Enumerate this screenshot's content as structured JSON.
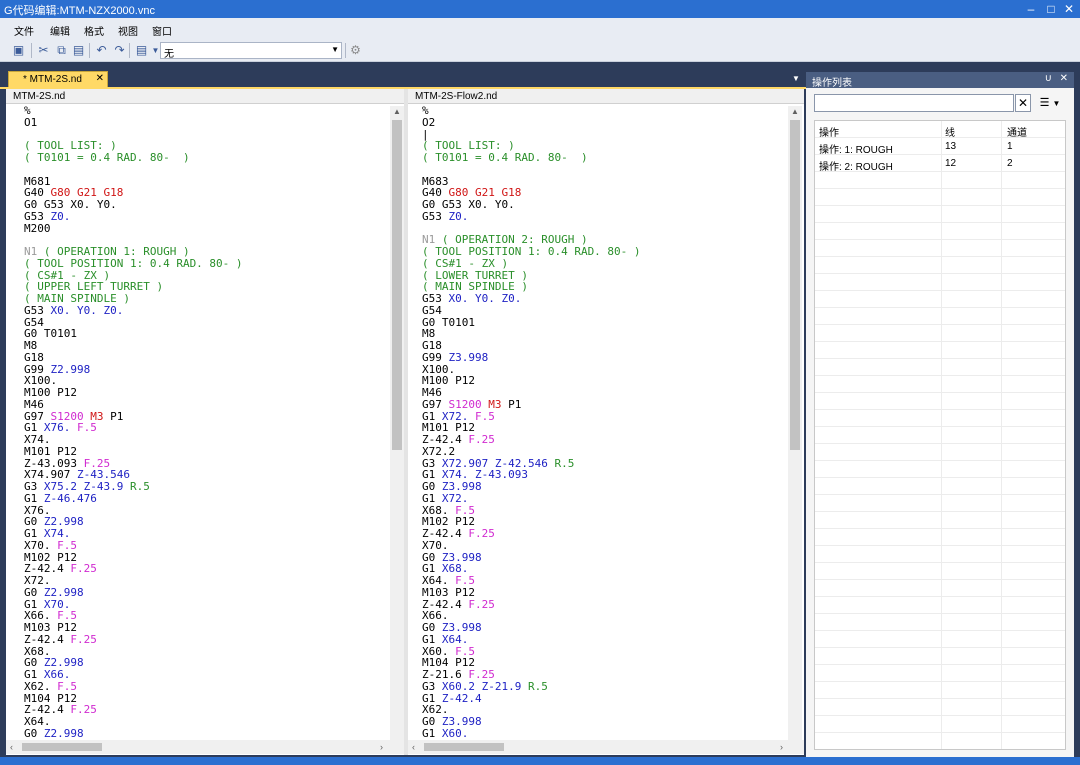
{
  "window": {
    "title": "G代码编辑:MTM-NZX2000.vnc"
  },
  "menu": [
    "文件",
    "编辑",
    "格式",
    "视图",
    "窗口"
  ],
  "toolbar": {
    "combo_value": "无"
  },
  "doc_tab": {
    "label": "* MTM-2S.nd"
  },
  "left_pane": {
    "filename": "MTM-2S.nd",
    "lines": [
      [
        [
          "k",
          "%"
        ]
      ],
      [
        [
          "k",
          "O1"
        ]
      ],
      [],
      [
        [
          "c",
          "( TOOL LIST: )"
        ]
      ],
      [
        [
          "c",
          "( T0101 = 0.4 RAD. 80-  )"
        ]
      ],
      [],
      [
        [
          "k",
          "M681"
        ]
      ],
      [
        [
          "k",
          "G40 "
        ],
        [
          "r",
          "G80 G21 G18"
        ]
      ],
      [
        [
          "k",
          "G0 G53 X0. Y0."
        ]
      ],
      [
        [
          "k",
          "G53 "
        ],
        [
          "b",
          "Z0."
        ]
      ],
      [
        [
          "k",
          "M200"
        ]
      ],
      [],
      [
        [
          "g",
          "N1 "
        ],
        [
          "c",
          "( OPERATION 1: ROUGH )"
        ]
      ],
      [
        [
          "c",
          "( TOOL POSITION 1: 0.4 RAD. 80- )"
        ]
      ],
      [
        [
          "c",
          "( CS#1 - ZX )"
        ]
      ],
      [
        [
          "c",
          "( UPPER LEFT TURRET )"
        ]
      ],
      [
        [
          "c",
          "( MAIN SPINDLE )"
        ]
      ],
      [
        [
          "k",
          "G53 "
        ],
        [
          "b",
          "X0. Y0. Z0."
        ]
      ],
      [
        [
          "k",
          "G54"
        ]
      ],
      [
        [
          "k",
          "G0 T0101"
        ]
      ],
      [
        [
          "k",
          "M8"
        ]
      ],
      [
        [
          "k",
          "G18"
        ]
      ],
      [
        [
          "k",
          "G99 "
        ],
        [
          "b",
          "Z2.998"
        ]
      ],
      [
        [
          "k",
          "X100."
        ]
      ],
      [
        [
          "k",
          "M100 P12"
        ]
      ],
      [
        [
          "k",
          "M46"
        ]
      ],
      [
        [
          "k",
          "G97 "
        ],
        [
          "m",
          "S1200 "
        ],
        [
          "r",
          "M3"
        ],
        [
          "k",
          " P1"
        ]
      ],
      [
        [
          "k",
          "G1 "
        ],
        [
          "b",
          "X76. "
        ],
        [
          "m",
          "F.5"
        ]
      ],
      [
        [
          "k",
          "X74."
        ]
      ],
      [
        [
          "k",
          "M101 P12"
        ]
      ],
      [
        [
          "k",
          "Z-43.093 "
        ],
        [
          "m",
          "F.25"
        ]
      ],
      [
        [
          "k",
          "X74.907 "
        ],
        [
          "b",
          "Z-43.546"
        ]
      ],
      [
        [
          "k",
          "G3 "
        ],
        [
          "b",
          "X75.2 Z-43.9 "
        ],
        [
          "c",
          "R.5"
        ]
      ],
      [
        [
          "k",
          "G1 "
        ],
        [
          "b",
          "Z-46.476"
        ]
      ],
      [
        [
          "k",
          "X76."
        ]
      ],
      [
        [
          "k",
          "G0 "
        ],
        [
          "b",
          "Z2.998"
        ]
      ],
      [
        [
          "k",
          "G1 "
        ],
        [
          "b",
          "X74."
        ]
      ],
      [
        [
          "k",
          "X70. "
        ],
        [
          "m",
          "F.5"
        ]
      ],
      [
        [
          "k",
          "M102 P12"
        ]
      ],
      [
        [
          "k",
          "Z-42.4 "
        ],
        [
          "m",
          "F.25"
        ]
      ],
      [
        [
          "k",
          "X72."
        ]
      ],
      [
        [
          "k",
          "G0 "
        ],
        [
          "b",
          "Z2.998"
        ]
      ],
      [
        [
          "k",
          "G1 "
        ],
        [
          "b",
          "X70."
        ]
      ],
      [
        [
          "k",
          "X66. "
        ],
        [
          "m",
          "F.5"
        ]
      ],
      [
        [
          "k",
          "M103 P12"
        ]
      ],
      [
        [
          "k",
          "Z-42.4 "
        ],
        [
          "m",
          "F.25"
        ]
      ],
      [
        [
          "k",
          "X68."
        ]
      ],
      [
        [
          "k",
          "G0 "
        ],
        [
          "b",
          "Z2.998"
        ]
      ],
      [
        [
          "k",
          "G1 "
        ],
        [
          "b",
          "X66."
        ]
      ],
      [
        [
          "k",
          "X62. "
        ],
        [
          "m",
          "F.5"
        ]
      ],
      [
        [
          "k",
          "M104 P12"
        ]
      ],
      [
        [
          "k",
          "Z-42.4 "
        ],
        [
          "m",
          "F.25"
        ]
      ],
      [
        [
          "k",
          "X64."
        ]
      ],
      [
        [
          "k",
          "G0 "
        ],
        [
          "b",
          "Z2.998"
        ]
      ]
    ]
  },
  "right_pane": {
    "filename": "MTM-2S-Flow2.nd",
    "lines": [
      [
        [
          "k",
          "%"
        ]
      ],
      [
        [
          "k",
          "O2"
        ]
      ],
      [
        [
          "k",
          "|"
        ]
      ],
      [
        [
          "c",
          "( TOOL LIST: )"
        ]
      ],
      [
        [
          "c",
          "( T0101 = 0.4 RAD. 80-  )"
        ]
      ],
      [],
      [
        [
          "k",
          "M683"
        ]
      ],
      [
        [
          "k",
          "G40 "
        ],
        [
          "r",
          "G80 G21 G18"
        ]
      ],
      [
        [
          "k",
          "G0 G53 X0. Y0."
        ]
      ],
      [
        [
          "k",
          "G53 "
        ],
        [
          "b",
          "Z0."
        ]
      ],
      [],
      [
        [
          "g",
          "N1 "
        ],
        [
          "c",
          "( OPERATION 2: ROUGH )"
        ]
      ],
      [
        [
          "c",
          "( TOOL POSITION 1: 0.4 RAD. 80- )"
        ]
      ],
      [
        [
          "c",
          "( CS#1 - ZX )"
        ]
      ],
      [
        [
          "c",
          "( LOWER TURRET )"
        ]
      ],
      [
        [
          "c",
          "( MAIN SPINDLE )"
        ]
      ],
      [
        [
          "k",
          "G53 "
        ],
        [
          "b",
          "X0. Y0. Z0."
        ]
      ],
      [
        [
          "k",
          "G54"
        ]
      ],
      [
        [
          "k",
          "G0 T0101"
        ]
      ],
      [
        [
          "k",
          "M8"
        ]
      ],
      [
        [
          "k",
          "G18"
        ]
      ],
      [
        [
          "k",
          "G99 "
        ],
        [
          "b",
          "Z3.998"
        ]
      ],
      [
        [
          "k",
          "X100."
        ]
      ],
      [
        [
          "k",
          "M100 P12"
        ]
      ],
      [
        [
          "k",
          "M46"
        ]
      ],
      [
        [
          "k",
          "G97 "
        ],
        [
          "m",
          "S1200 "
        ],
        [
          "r",
          "M3"
        ],
        [
          "k",
          " P1"
        ]
      ],
      [
        [
          "k",
          "G1 "
        ],
        [
          "b",
          "X72. "
        ],
        [
          "m",
          "F.5"
        ]
      ],
      [
        [
          "k",
          "M101 P12"
        ]
      ],
      [
        [
          "k",
          "Z-42.4 "
        ],
        [
          "m",
          "F.25"
        ]
      ],
      [
        [
          "k",
          "X72.2"
        ]
      ],
      [
        [
          "k",
          "G3 "
        ],
        [
          "b",
          "X72.907 Z-42.546 "
        ],
        [
          "c",
          "R.5"
        ]
      ],
      [
        [
          "k",
          "G1 "
        ],
        [
          "b",
          "X74. Z-43.093"
        ]
      ],
      [
        [
          "k",
          "G0 "
        ],
        [
          "b",
          "Z3.998"
        ]
      ],
      [
        [
          "k",
          "G1 "
        ],
        [
          "b",
          "X72."
        ]
      ],
      [
        [
          "k",
          "X68. "
        ],
        [
          "m",
          "F.5"
        ]
      ],
      [
        [
          "k",
          "M102 P12"
        ]
      ],
      [
        [
          "k",
          "Z-42.4 "
        ],
        [
          "m",
          "F.25"
        ]
      ],
      [
        [
          "k",
          "X70."
        ]
      ],
      [
        [
          "k",
          "G0 "
        ],
        [
          "b",
          "Z3.998"
        ]
      ],
      [
        [
          "k",
          "G1 "
        ],
        [
          "b",
          "X68."
        ]
      ],
      [
        [
          "k",
          "X64. "
        ],
        [
          "m",
          "F.5"
        ]
      ],
      [
        [
          "k",
          "M103 P12"
        ]
      ],
      [
        [
          "k",
          "Z-42.4 "
        ],
        [
          "m",
          "F.25"
        ]
      ],
      [
        [
          "k",
          "X66."
        ]
      ],
      [
        [
          "k",
          "G0 "
        ],
        [
          "b",
          "Z3.998"
        ]
      ],
      [
        [
          "k",
          "G1 "
        ],
        [
          "b",
          "X64."
        ]
      ],
      [
        [
          "k",
          "X60. "
        ],
        [
          "m",
          "F.5"
        ]
      ],
      [
        [
          "k",
          "M104 P12"
        ]
      ],
      [
        [
          "k",
          "Z-21.6 "
        ],
        [
          "m",
          "F.25"
        ]
      ],
      [
        [
          "k",
          "G3 "
        ],
        [
          "b",
          "X60.2 Z-21.9 "
        ],
        [
          "c",
          "R.5"
        ]
      ],
      [
        [
          "k",
          "G1 "
        ],
        [
          "b",
          "Z-42.4"
        ]
      ],
      [
        [
          "k",
          "X62."
        ]
      ],
      [
        [
          "k",
          "G0 "
        ],
        [
          "b",
          "Z3.998"
        ]
      ],
      [
        [
          "k",
          "G1 "
        ],
        [
          "b",
          "X60."
        ]
      ]
    ]
  },
  "op_panel": {
    "title": "操作列表",
    "search_value": "",
    "columns": [
      "操作",
      "线",
      "通道"
    ],
    "rows": [
      [
        "操作: 1: ROUGH",
        "13",
        "1"
      ],
      [
        "操作: 2: ROUGH",
        "12",
        "2"
      ]
    ]
  }
}
